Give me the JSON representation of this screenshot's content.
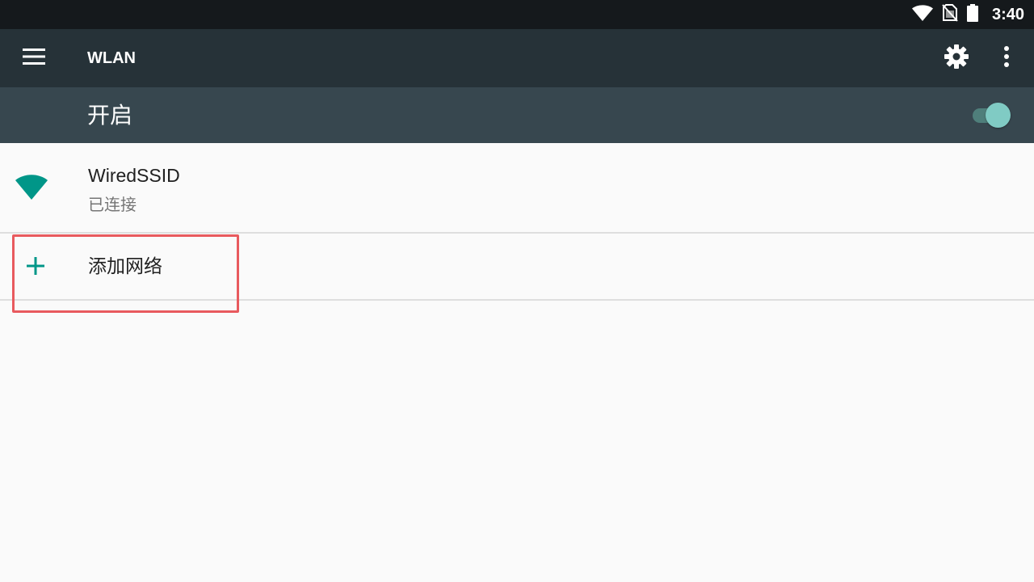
{
  "status_bar": {
    "time": "3:40",
    "icons": [
      "wifi-signal-icon",
      "no-sim-icon",
      "battery-icon"
    ]
  },
  "app_bar": {
    "title": "WLAN",
    "icons": [
      "menu-icon",
      "settings-gear-icon",
      "overflow-menu-icon"
    ]
  },
  "switch_bar": {
    "label": "开启",
    "state": "on",
    "thumb_color": "#80cbc4",
    "track_color": "#4f7f7b"
  },
  "networks": [
    {
      "ssid": "WiredSSID",
      "status": "已连接",
      "icon": "wifi-full-icon",
      "icon_color": "#009688"
    }
  ],
  "add_network": {
    "label": "添加网络",
    "icon": "plus-icon",
    "icon_color": "#009688"
  },
  "colors": {
    "status_bar_bg": "#15191c",
    "app_bar_bg": "#263238",
    "switch_bar_bg": "#37474f",
    "list_bg": "#fafafa",
    "highlight": "#e85a5e"
  }
}
